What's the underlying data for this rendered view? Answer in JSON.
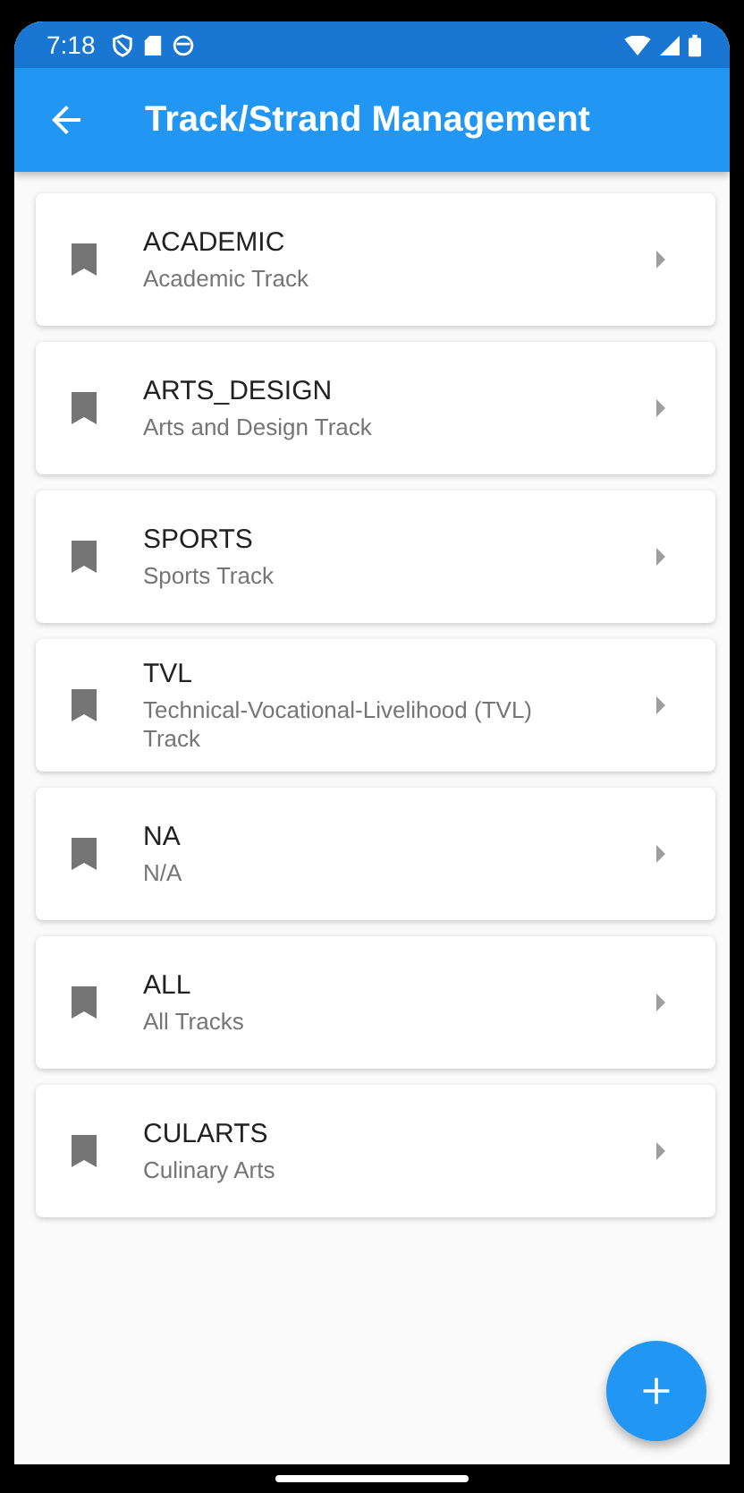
{
  "status_bar": {
    "time": "7:18"
  },
  "app_bar": {
    "title": "Track/Strand Management"
  },
  "tracks": [
    {
      "code": "ACADEMIC",
      "name": "Academic Track"
    },
    {
      "code": "ARTS_DESIGN",
      "name": "Arts and Design Track"
    },
    {
      "code": "SPORTS",
      "name": "Sports Track"
    },
    {
      "code": "TVL",
      "name": "Technical-Vocational-Livelihood (TVL) Track"
    },
    {
      "code": "NA",
      "name": "N/A"
    },
    {
      "code": "ALL",
      "name": "All Tracks"
    },
    {
      "code": "CULARTS",
      "name": "Culinary Arts"
    }
  ]
}
